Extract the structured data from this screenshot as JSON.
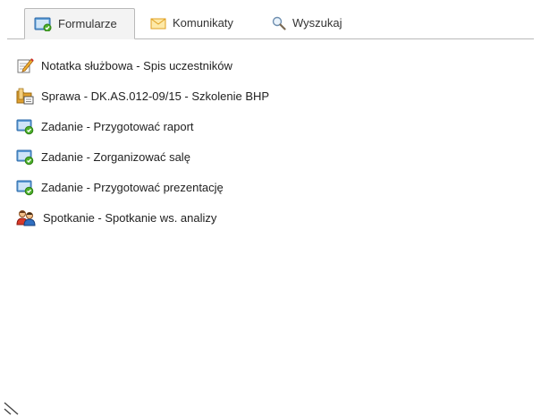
{
  "tabs": [
    {
      "label": "Formularze",
      "icon": "form-icon",
      "active": true
    },
    {
      "label": "Komunikaty",
      "icon": "envelope-icon",
      "active": false
    },
    {
      "label": "Wyszukaj",
      "icon": "magnifier-icon",
      "active": false
    }
  ],
  "items": [
    {
      "label": "Notatka służbowa - Spis uczestników",
      "icon": "note-pencil-icon"
    },
    {
      "label": "Sprawa - DK.AS.012-09/15 - Szkolenie BHP",
      "icon": "case-folder-icon"
    },
    {
      "label": "Zadanie - Przygotować raport",
      "icon": "task-icon"
    },
    {
      "label": "Zadanie - Zorganizować salę",
      "icon": "task-icon"
    },
    {
      "label": "Zadanie - Przygotować prezentację",
      "icon": "task-icon"
    },
    {
      "label": "Spotkanie - Spotkanie ws. analizy",
      "icon": "meeting-people-icon"
    }
  ]
}
